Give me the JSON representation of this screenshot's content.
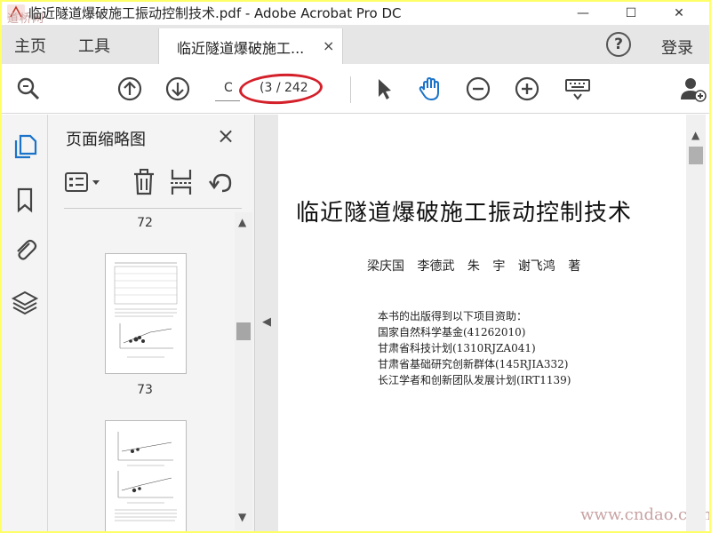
{
  "window": {
    "title": "临近隧道爆破施工振动控制技术.pdf - Adobe Acrobat Pro DC",
    "watermark_logo_text": "道桥网",
    "min_symbol": "—",
    "max_symbol": "☐",
    "close_symbol": "✕"
  },
  "tabs": {
    "home_label": "主页",
    "tools_label": "工具",
    "doc_label": "临近隧道爆破施工...",
    "doc_close": "×",
    "help_symbol": "?",
    "login_label": "登录"
  },
  "toolbar": {
    "page_input_value": "C",
    "page_count": "(3 / 242",
    "icons": [
      "search-zoom-icon",
      "page-up-icon",
      "page-down-icon",
      "select-arrow-icon",
      "hand-icon",
      "zoom-out-icon",
      "zoom-in-icon",
      "keyboard-icon",
      "add-user-icon"
    ],
    "accent_color": "#1a73c8",
    "highlight_color": "#d4202a"
  },
  "sidebar": {
    "icons": [
      "page-thumbnails-icon",
      "bookmark-icon",
      "attachment-icon",
      "layers-icon"
    ]
  },
  "thumbnail_panel": {
    "title": "页面缩略图",
    "close": "×",
    "tools": [
      "options-icon",
      "delete-icon",
      "extract-icon",
      "rotate-icon"
    ],
    "labels": [
      "72",
      "73"
    ]
  },
  "document": {
    "title": "临近隧道爆破施工振动控制技术",
    "authors": "梁庆国 李德武 朱 宇 谢飞鸿 著",
    "funding": [
      "本书的出版得到以下项目资助：",
      "国家自然科学基金(41262010)",
      "甘肃省科技计划(1310RJZA041)",
      "甘肃省基础研究创新群体(145RJIA332)",
      "长江学者和创新团队发展计划(IRT1139)"
    ],
    "watermark": "www.cndao.com"
  }
}
